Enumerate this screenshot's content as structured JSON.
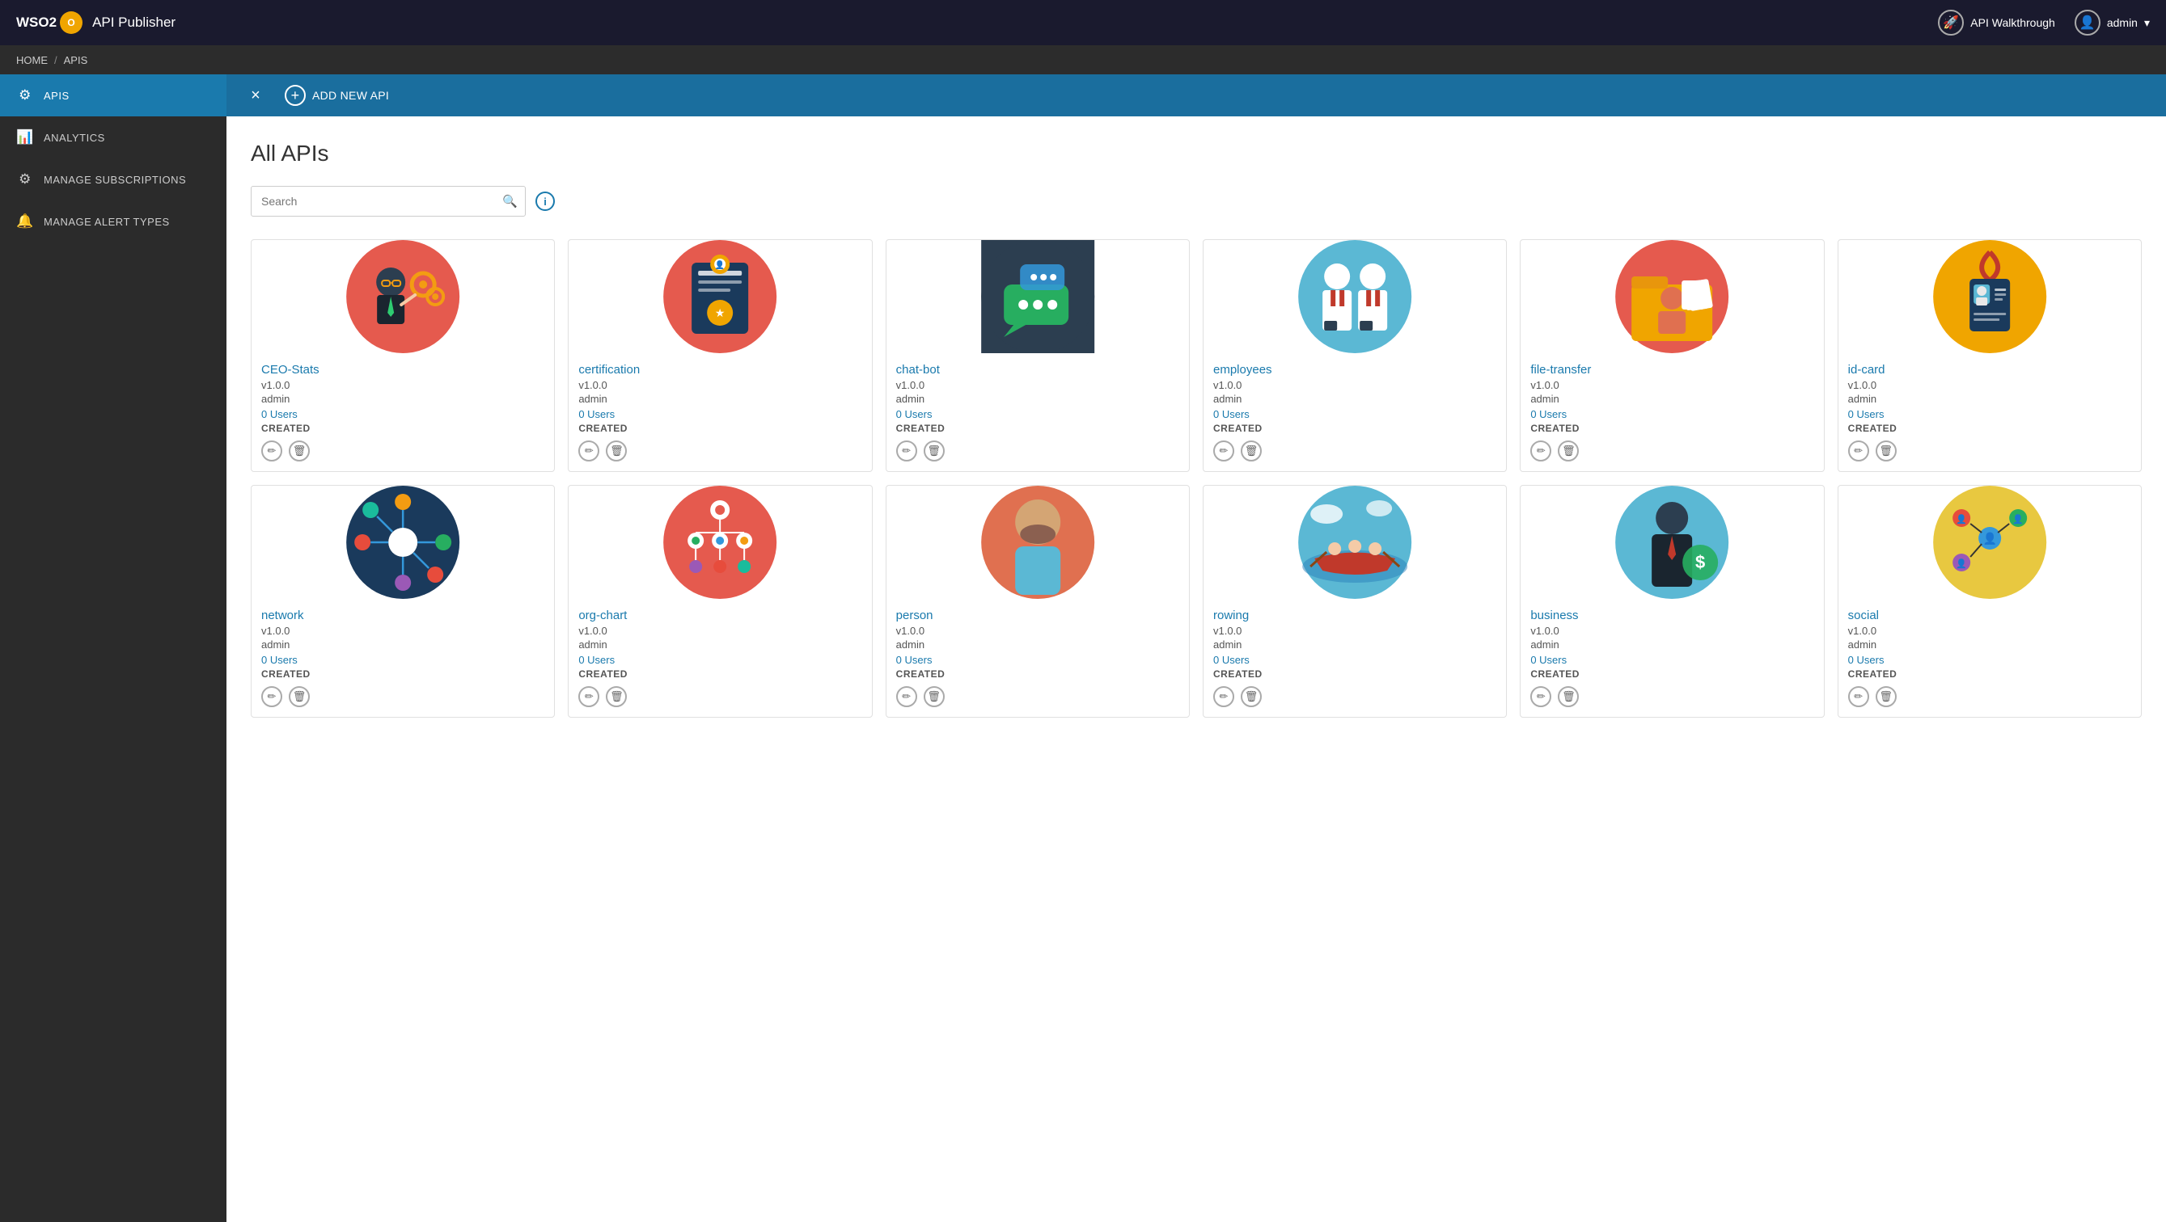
{
  "app": {
    "title": "API Publisher",
    "brand": "WSO2"
  },
  "navbar": {
    "walkthrough_label": "API Walkthrough",
    "user_label": "admin",
    "chevron": "▾"
  },
  "breadcrumb": {
    "home": "HOME",
    "separator": "/",
    "current": "APIS"
  },
  "sidebar": {
    "items": [
      {
        "id": "apis",
        "label": "APIS",
        "icon": "⚙",
        "active": true
      },
      {
        "id": "analytics",
        "label": "ANALYTICS",
        "icon": "📊",
        "active": false
      },
      {
        "id": "subscriptions",
        "label": "MANAGE SUBSCRIPTIONS",
        "icon": "⚙",
        "active": false
      },
      {
        "id": "alerts",
        "label": "MANAGE ALERT TYPES",
        "icon": "🔔",
        "active": false
      }
    ]
  },
  "action_bar": {
    "close_label": "×",
    "add_label": "ADD NEW API"
  },
  "main": {
    "title": "All APIs",
    "search_placeholder": "Search",
    "apis": [
      {
        "name": "CEO-Stats",
        "version": "v1.0.0",
        "owner": "admin",
        "users": "0 Users",
        "status": "CREATED",
        "color": "#e55a4e"
      },
      {
        "name": "certification",
        "version": "v1.0.0",
        "owner": "admin",
        "users": "0 Users",
        "status": "CREATED",
        "color": "#e55a4e"
      },
      {
        "name": "chat-bot",
        "version": "v1.0.0",
        "owner": "admin",
        "users": "0 Users",
        "status": "CREATED",
        "color": "#2c3e50"
      },
      {
        "name": "employees",
        "version": "v1.0.0",
        "owner": "admin",
        "users": "0 Users",
        "status": "CREATED",
        "color": "#5bb8d4"
      },
      {
        "name": "file-transfer",
        "version": "v1.0.0",
        "owner": "admin",
        "users": "0 Users",
        "status": "CREATED",
        "color": "#e55a4e"
      },
      {
        "name": "id-card",
        "version": "v1.0.0",
        "owner": "admin",
        "users": "0 Users",
        "status": "CREATED",
        "color": "#1a3a5c"
      },
      {
        "name": "network",
        "version": "v1.0.0",
        "owner": "admin",
        "users": "0 Users",
        "status": "CREATED",
        "color": "#1a3a5c"
      },
      {
        "name": "org-chart",
        "version": "v1.0.0",
        "owner": "admin",
        "users": "0 Users",
        "status": "CREATED",
        "color": "#e55a4e"
      },
      {
        "name": "person",
        "version": "v1.0.0",
        "owner": "admin",
        "users": "0 Users",
        "status": "CREATED",
        "color": "#e07050"
      },
      {
        "name": "rowing",
        "version": "v1.0.0",
        "owner": "admin",
        "users": "0 Users",
        "status": "CREATED",
        "color": "#5bb8d4"
      },
      {
        "name": "business",
        "version": "v1.0.0",
        "owner": "admin",
        "users": "0 Users",
        "status": "CREATED",
        "color": "#5bb8d4"
      },
      {
        "name": "social",
        "version": "v1.0.0",
        "owner": "admin",
        "users": "0 Users",
        "status": "CREATED",
        "color": "#e8c840"
      }
    ]
  }
}
